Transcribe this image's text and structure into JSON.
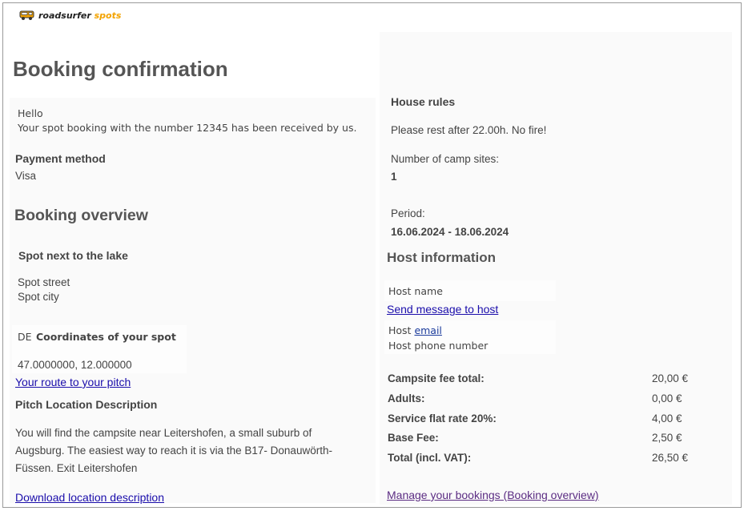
{
  "brand": {
    "logo_text_main": "roadsurfer",
    "logo_text_accent": "spots"
  },
  "page": {
    "title": "Booking confirmation"
  },
  "greeting": {
    "hello": "Hello",
    "message": "Your spot booking with the number 12345 has been received by us."
  },
  "payment": {
    "heading": "Payment method",
    "value": "Visa"
  },
  "overview": {
    "heading": "Booking overview",
    "spot_name": "Spot next to the lake",
    "street": "Spot street",
    "city": "Spot city",
    "country_code": "DE",
    "coordinates_label": "Coordinates of your spot",
    "coordinates": "47.0000000, 12.000000",
    "route_link": "Your route to your pitch"
  },
  "pitch": {
    "heading": "Pitch Location Description",
    "line1": "You will find the campsite near Leitershofen, a small suburb of",
    "line2": "Augsburg. The easiest way to reach it is via the B17- Donauwörth-",
    "line3": "Füssen. Exit Leitershofen",
    "download_link": "Download location description"
  },
  "house_rules": {
    "heading": "House rules",
    "text": "Please rest after 22.00h. No fire!",
    "sites_label": "Number of camp sites:",
    "sites_value": "1",
    "period_label": "Period:",
    "period_value": "16.06.2024 - 18.06.2024"
  },
  "host": {
    "heading": "Host information",
    "name": "Host name",
    "message_link": "Send message to host",
    "email_prefix": "Host ",
    "email_link": "email",
    "phone": "Host phone number"
  },
  "fees": [
    {
      "label": "Campsite fee total:",
      "value": "20,00 €"
    },
    {
      "label": "Adults:",
      "value": "0,00 €"
    },
    {
      "label": "Service flat rate 20%:",
      "value": "4,00 €"
    },
    {
      "label": "Base Fee:",
      "value": "2,50 €"
    },
    {
      "label": "Total (incl. VAT):",
      "value": "26,50 €"
    }
  ],
  "footer": {
    "manage_link": "Manage your bookings (Booking overview)"
  },
  "colors": {
    "link": "#1a0dab",
    "visited_link": "#5b2c83",
    "heading": "#555555",
    "logo_accent": "#f3a300"
  }
}
